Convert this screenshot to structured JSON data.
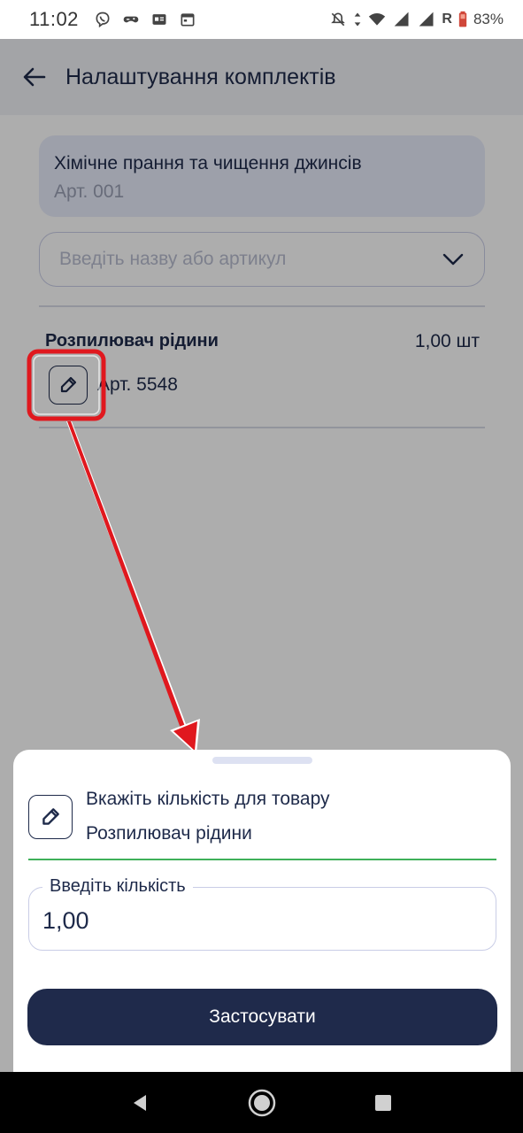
{
  "status_bar": {
    "time": "11:02",
    "battery": "83%",
    "network_label": "R",
    "icons": [
      "viber-icon",
      "gamepad-icon",
      "id-card-icon",
      "calendar-icon",
      "mute-icon",
      "data-arrows-icon",
      "wifi-icon",
      "signal-icon",
      "battery-icon"
    ]
  },
  "app_bar": {
    "title": "Налаштування комплектів"
  },
  "kit": {
    "name": "Хімічне прання та чищення  джинсів",
    "article": "Арт. 001"
  },
  "search": {
    "placeholder": "Введіть назву або артикул"
  },
  "items": [
    {
      "name": "Розпилювач рідини",
      "quantity": "1,00 шт",
      "article": "Арт. 5548"
    }
  ],
  "sheet": {
    "line1": "Вкажіть кількість для товару",
    "line2": "Розпилювач рідини",
    "qty_label": "Введіть кількість",
    "qty_value": "1,00",
    "apply_label": "Застосувати"
  },
  "colors": {
    "primary": "#1f2a4b",
    "accent_line": "#3fb05a",
    "kit_card_bg": "#e8ecfb",
    "annotation_red": "#e0181e"
  }
}
